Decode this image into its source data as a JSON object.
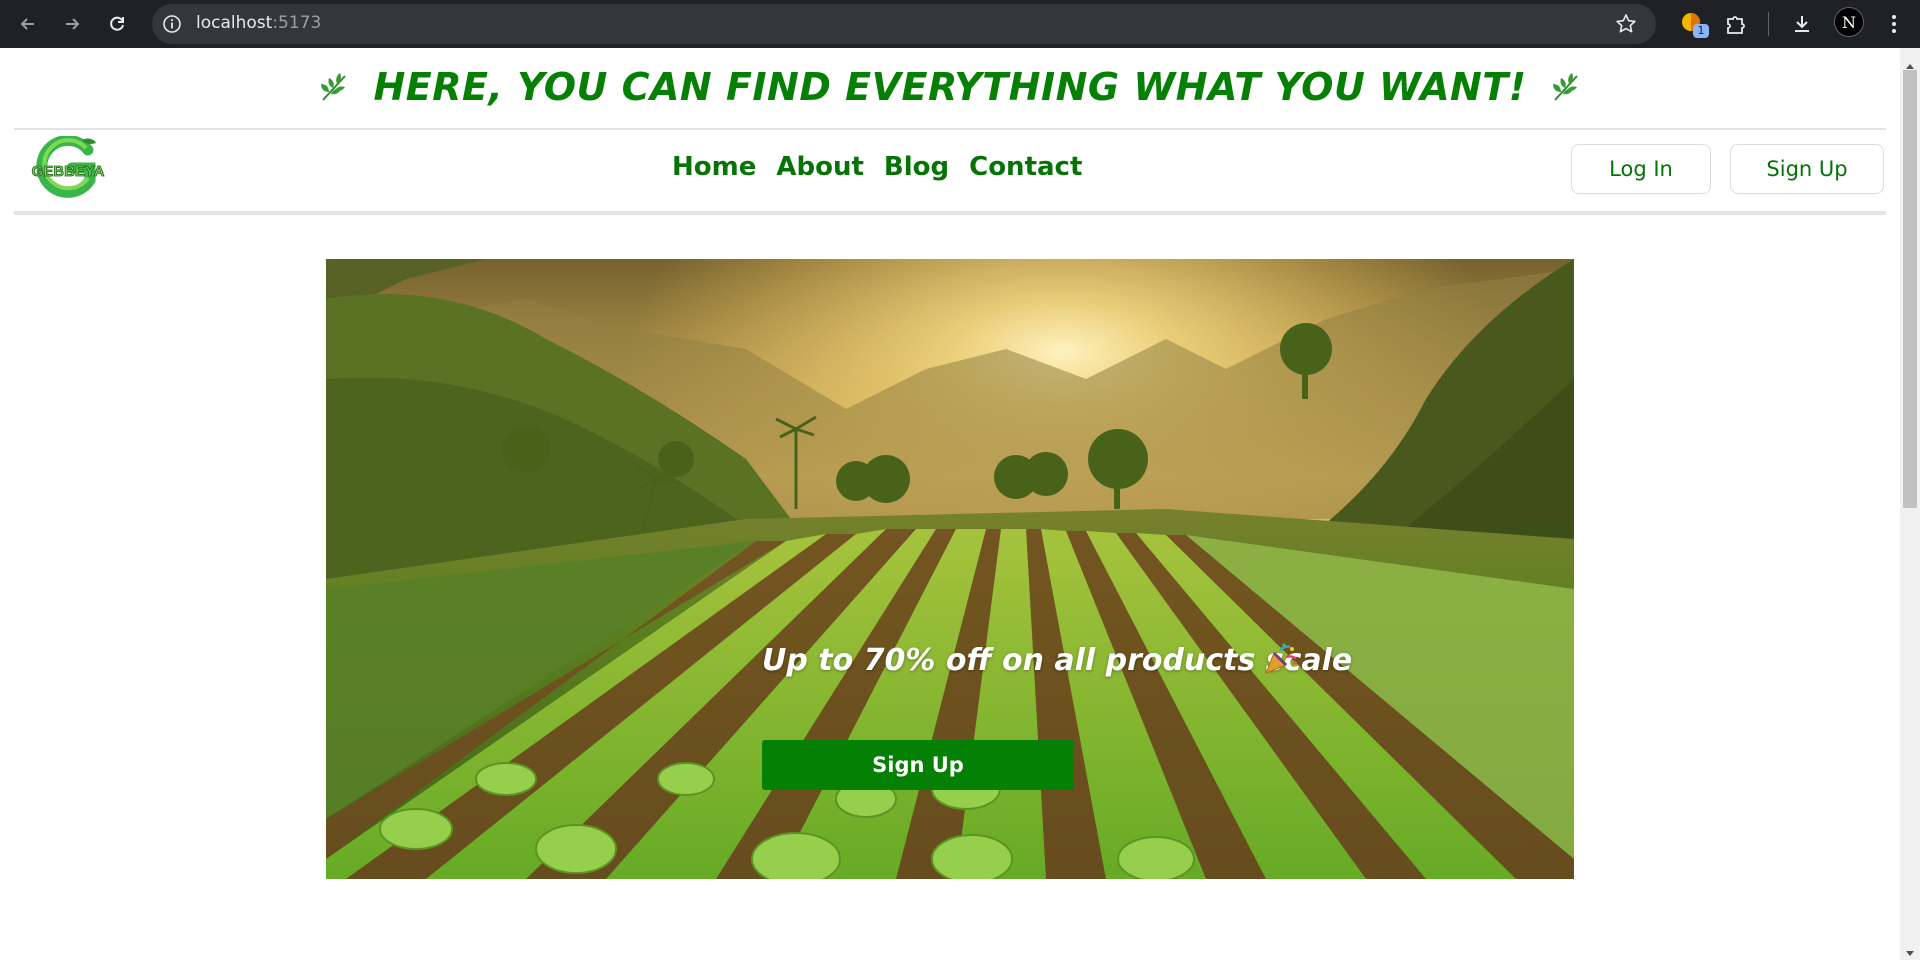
{
  "browser": {
    "url_host": "localhost",
    "url_port": ":5173",
    "extension_badge": "1",
    "profile_initial": "N",
    "icons": [
      "back-arrow-icon",
      "forward-arrow-icon",
      "reload-icon",
      "site-info-icon",
      "bookmark-star-icon",
      "extension-icon",
      "puzzle-icon",
      "download-icon",
      "kebab-menu-icon"
    ]
  },
  "promo": {
    "text": "HERE, YOU CAN FIND EVERYTHING WHAT YOU WANT!",
    "icon": "leaf-icon"
  },
  "navbar": {
    "logo_text": "GEBBEYA",
    "links": [
      "Home",
      "About",
      "Blog",
      "Contact"
    ],
    "login_label": "Log In",
    "signup_label": "Sign Up"
  },
  "hero": {
    "headline": "Up to 70% off on all products scale",
    "headline_icon": "party-popper-icon",
    "cta_label": "Sign Up"
  },
  "colors": {
    "brand_green": "#058005",
    "nav_green": "#067306",
    "cta_green": "#048004",
    "chrome_dark": "#202124"
  }
}
